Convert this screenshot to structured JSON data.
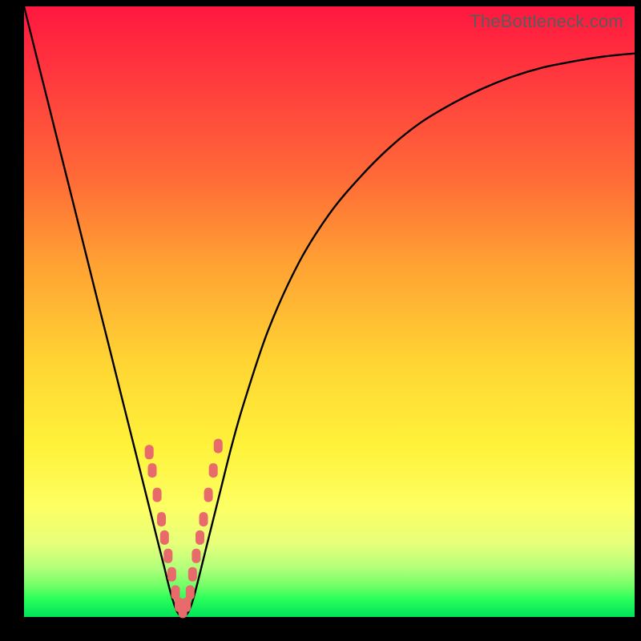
{
  "watermark": "TheBottleneck.com",
  "colors": {
    "background": "#000000",
    "curve": "#000000",
    "markers": "#e86a6b",
    "gradient_top": "#ff173f",
    "gradient_bottom": "#00e35b"
  },
  "chart_data": {
    "type": "line",
    "title": "",
    "xlabel": "",
    "ylabel": "",
    "xlim": [
      0,
      100
    ],
    "ylim": [
      0,
      100
    ],
    "series": [
      {
        "name": "bottleneck-curve",
        "x": [
          0,
          2,
          4,
          6,
          8,
          10,
          12,
          14,
          16,
          18,
          20,
          22,
          23,
          24,
          25,
          26,
          27,
          28,
          30,
          32,
          34,
          36,
          40,
          45,
          50,
          55,
          60,
          65,
          70,
          75,
          80,
          85,
          90,
          95,
          100
        ],
        "y": [
          100,
          92,
          84,
          76,
          68,
          60,
          52,
          44,
          36,
          28,
          20,
          12,
          8,
          4,
          1,
          0,
          1,
          4,
          12,
          20,
          28,
          35,
          47,
          58,
          66,
          72,
          77,
          81,
          84,
          86.5,
          88.5,
          90,
          91,
          91.8,
          92.3
        ]
      }
    ],
    "markers": {
      "name": "highlight-points",
      "x": [
        20.5,
        21.0,
        21.8,
        22.5,
        23.0,
        23.6,
        24.2,
        24.8,
        25.4,
        26.0,
        26.6,
        27.2,
        27.6,
        28.2,
        28.8,
        29.4,
        30.2,
        31.0,
        31.8
      ],
      "y": [
        27,
        24,
        20,
        16,
        13,
        10,
        7,
        4,
        2,
        1,
        2,
        4,
        7,
        10,
        13,
        16,
        20,
        24,
        28
      ]
    }
  }
}
